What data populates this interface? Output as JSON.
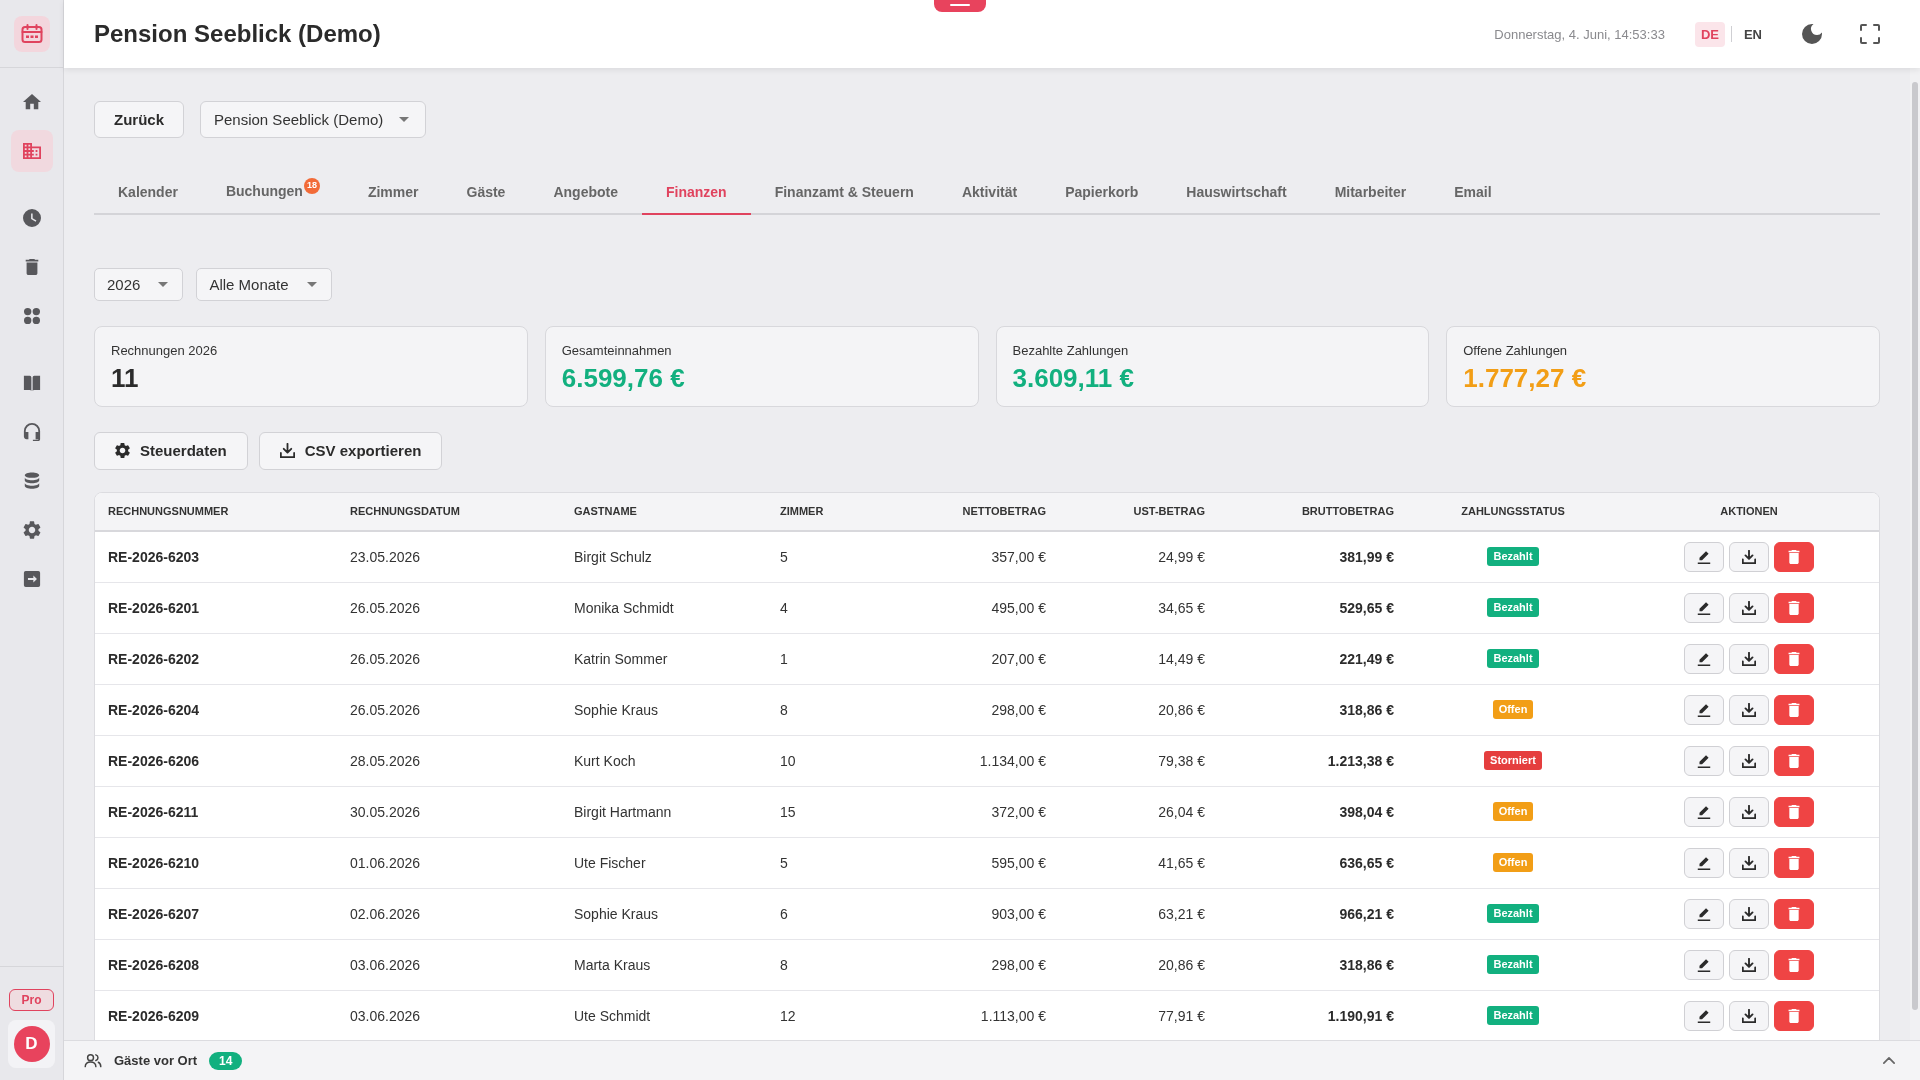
{
  "sidebar": {
    "groups": [
      [
        {
          "kind": "home",
          "selected": false
        },
        {
          "kind": "building",
          "selected": true
        }
      ],
      [
        {
          "kind": "clock",
          "selected": false
        },
        {
          "kind": "trash",
          "selected": false
        },
        {
          "kind": "apps",
          "selected": false
        }
      ],
      [
        {
          "kind": "book",
          "selected": false
        },
        {
          "kind": "headset",
          "selected": false
        },
        {
          "kind": "database",
          "selected": false
        },
        {
          "kind": "settings",
          "selected": false
        },
        {
          "kind": "logout",
          "selected": false
        }
      ]
    ],
    "plan_badge": "Pro",
    "avatar_initial": "D"
  },
  "header": {
    "title": "Pension Seeblick (Demo)",
    "datetime": "Donnerstag, 4. Juni, 14:53:33",
    "languages": [
      {
        "label": "DE",
        "selected": true
      },
      {
        "label": "EN",
        "selected": false
      }
    ]
  },
  "toolbar": {
    "back_button": "Zurück",
    "property_select": "Pension Seeblick (Demo)"
  },
  "tabs": [
    {
      "label": "Kalender",
      "selected": false
    },
    {
      "label": "Buchungen",
      "selected": false,
      "badge": "18"
    },
    {
      "label": "Zimmer",
      "selected": false
    },
    {
      "label": "Gäste",
      "selected": false
    },
    {
      "label": "Angebote",
      "selected": false
    },
    {
      "label": "Finanzen",
      "selected": true
    },
    {
      "label": "Finanzamt & Steuern",
      "selected": false
    },
    {
      "label": "Aktivität",
      "selected": false
    },
    {
      "label": "Papierkorb",
      "selected": false
    },
    {
      "label": "Hauswirtschaft",
      "selected": false
    },
    {
      "label": "Mitarbeiter",
      "selected": false
    },
    {
      "label": "Email",
      "selected": false
    }
  ],
  "filters": [
    "2026",
    "Alle Monate"
  ],
  "stats": [
    {
      "label": "Rechnungen 2026",
      "value": "11",
      "color": "#2b2b2b"
    },
    {
      "label": "Gesamteinnahmen",
      "value": "6.599,76 €",
      "color": "#12b07f"
    },
    {
      "label": "Bezahlte Zahlungen",
      "value": "3.609,11 €",
      "color": "#12b07f"
    },
    {
      "label": "Offene Zahlungen",
      "value": "1.777,27 €",
      "color": "#f29e16"
    }
  ],
  "actions": [
    {
      "label": "Steuerdaten",
      "kind": "settings"
    },
    {
      "label": "CSV exportieren",
      "kind": "export"
    }
  ],
  "table": {
    "columns": [
      "RECHNUNGSNUMMER",
      "RECHNUNGSDATUM",
      "GASTNAME",
      "ZIMMER",
      "NETTOBETRAG",
      "UST-BETRAG",
      "BRUTTOBETRAG",
      "ZAHLUNGSSTATUS",
      "AKTIONEN"
    ],
    "rows": [
      {
        "invoice_number": "RE-2026-6203",
        "date": "23.05.2026",
        "guest": "Birgit Schulz",
        "room": "5",
        "net": "357,00 €",
        "vat": "24,99 €",
        "gross": "381,99 €",
        "status": {
          "label": "Bezahlt",
          "color": "#12b07f"
        }
      },
      {
        "invoice_number": "RE-2026-6201",
        "date": "26.05.2026",
        "guest": "Monika Schmidt",
        "room": "4",
        "net": "495,00 €",
        "vat": "34,65 €",
        "gross": "529,65 €",
        "status": {
          "label": "Bezahlt",
          "color": "#12b07f"
        }
      },
      {
        "invoice_number": "RE-2026-6202",
        "date": "26.05.2026",
        "guest": "Katrin Sommer",
        "room": "1",
        "net": "207,00 €",
        "vat": "14,49 €",
        "gross": "221,49 €",
        "status": {
          "label": "Bezahlt",
          "color": "#12b07f"
        }
      },
      {
        "invoice_number": "RE-2026-6204",
        "date": "26.05.2026",
        "guest": "Sophie Kraus",
        "room": "8",
        "net": "298,00 €",
        "vat": "20,86 €",
        "gross": "318,86 €",
        "status": {
          "label": "Offen",
          "color": "#f29e16"
        }
      },
      {
        "invoice_number": "RE-2026-6206",
        "date": "28.05.2026",
        "guest": "Kurt Koch",
        "room": "10",
        "net": "1.134,00 €",
        "vat": "79,38 €",
        "gross": "1.213,38 €",
        "status": {
          "label": "Storniert",
          "color": "#e53e3e"
        }
      },
      {
        "invoice_number": "RE-2026-6211",
        "date": "30.05.2026",
        "guest": "Birgit Hartmann",
        "room": "15",
        "net": "372,00 €",
        "vat": "26,04 €",
        "gross": "398,04 €",
        "status": {
          "label": "Offen",
          "color": "#f29e16"
        }
      },
      {
        "invoice_number": "RE-2026-6210",
        "date": "01.06.2026",
        "guest": "Ute Fischer",
        "room": "5",
        "net": "595,00 €",
        "vat": "41,65 €",
        "gross": "636,65 €",
        "status": {
          "label": "Offen",
          "color": "#f29e16"
        }
      },
      {
        "invoice_number": "RE-2026-6207",
        "date": "02.06.2026",
        "guest": "Sophie Kraus",
        "room": "6",
        "net": "903,00 €",
        "vat": "63,21 €",
        "gross": "966,21 €",
        "status": {
          "label": "Bezahlt",
          "color": "#12b07f"
        }
      },
      {
        "invoice_number": "RE-2026-6208",
        "date": "03.06.2026",
        "guest": "Marta Kraus",
        "room": "8",
        "net": "298,00 €",
        "vat": "20,86 €",
        "gross": "318,86 €",
        "status": {
          "label": "Bezahlt",
          "color": "#12b07f"
        }
      },
      {
        "invoice_number": "RE-2026-6209",
        "date": "03.06.2026",
        "guest": "Ute Schmidt",
        "room": "12",
        "net": "1.113,00 €",
        "vat": "77,91 €",
        "gross": "1.190,91 €",
        "status": {
          "label": "Bezahlt",
          "color": "#12b07f"
        }
      }
    ]
  },
  "footer": {
    "label": "Gäste vor Ort",
    "count": "14"
  }
}
